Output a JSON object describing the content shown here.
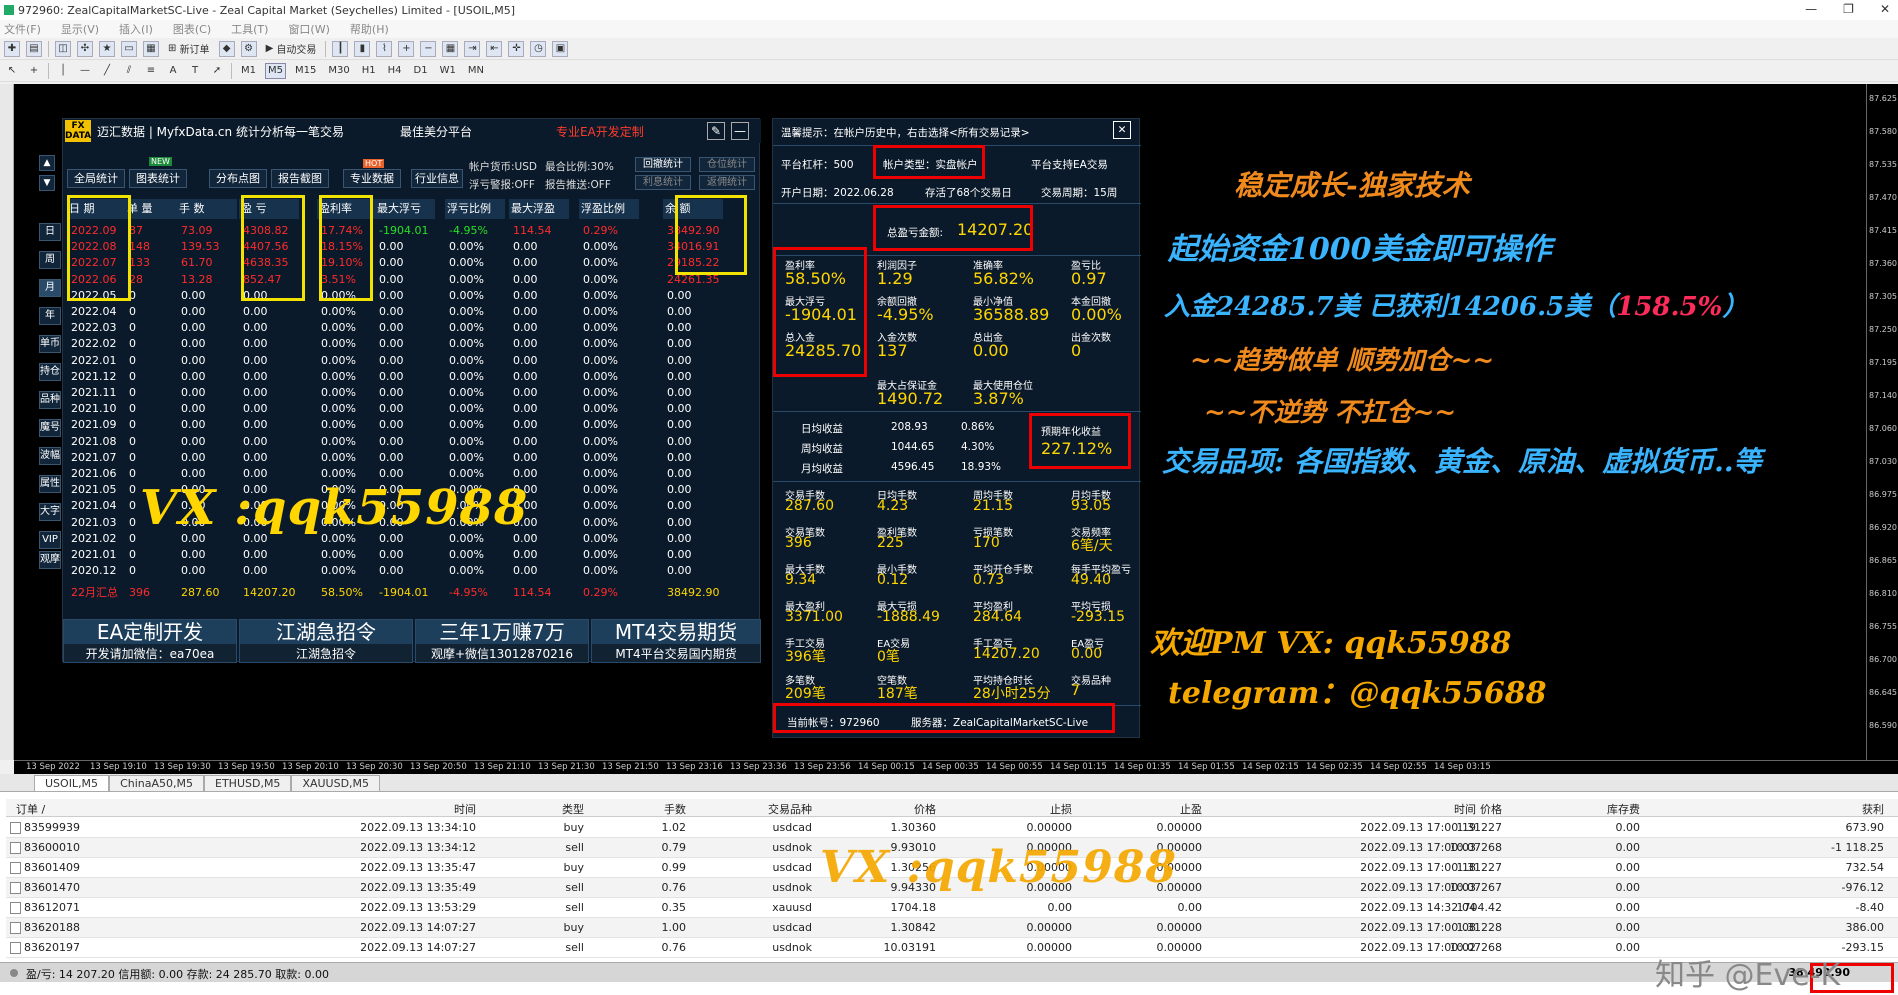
{
  "window": {
    "title": "972960: ZealCapitalMarketSC-Live - Zeal Capital Market (Seychelles) Limited - [USOIL,M5]",
    "controls": [
      "—",
      "❐",
      "✕"
    ]
  },
  "menu": [
    "文件(F)",
    "显示(V)",
    "插入(I)",
    "图表(C)",
    "工具(T)",
    "窗口(W)",
    "帮助(H)"
  ],
  "toolbar": {
    "new_order": "新订单",
    "autotrade": "自动交易",
    "timeframes": [
      "M1",
      "M5",
      "M15",
      "M30",
      "H1",
      "H4",
      "D1",
      "W1",
      "MN"
    ]
  },
  "left_panel": {
    "logo": "FX DATA",
    "header_title": "迈汇数据 | MyfxData.cn  统计分析每一笔交易",
    "header_mid": "最佳美分平台",
    "header_right": "专业EA开发定制",
    "buttons": [
      "全局统计",
      "图表统计",
      "分布点图",
      "报告截图",
      "专业数据",
      "行业信息"
    ],
    "new_badge": "NEW",
    "hot_badge": "HOT",
    "info": {
      "currency": "帐户货币:USD",
      "max_ratio": "最合比例:30%",
      "alarm": "浮亏警报:OFF",
      "push": "报告推送:OFF",
      "btn_withdraw": "回撤统计",
      "btn_position": "仓位统计",
      "btn_profit": "利息统计",
      "btn_rebate": "返佣统计"
    },
    "side_tabs": [
      "日",
      "周",
      "月",
      "年",
      "单币",
      "持仓",
      "品种",
      "魔号",
      "波幅",
      "属性",
      "大字",
      "VIP",
      "观摩"
    ],
    "columns": [
      "日 期",
      "单 量",
      "手 数",
      "盈 亏",
      "盈利率",
      "最大浮亏",
      "浮亏比例",
      "最大浮盈",
      "浮盈比例",
      "余 额"
    ],
    "rows": [
      [
        "2022.09",
        "87",
        "73.09",
        "4308.82",
        "17.74%",
        "-1904.01",
        "-4.95%",
        "114.54",
        "0.29%",
        "38492.90"
      ],
      [
        "2022.08",
        "148",
        "139.53",
        "4407.56",
        "18.15%",
        "0.00",
        "0.00%",
        "0.00",
        "0.00%",
        "34016.91"
      ],
      [
        "2022.07",
        "133",
        "61.70",
        "4638.35",
        "19.10%",
        "0.00",
        "0.00%",
        "0.00",
        "0.00%",
        "29185.22"
      ],
      [
        "2022.06",
        "28",
        "13.28",
        "852.47",
        "3.51%",
        "0.00",
        "0.00%",
        "0.00",
        "0.00%",
        "24261.35"
      ],
      [
        "2022.05",
        "0",
        "0.00",
        "0.00",
        "0.00%",
        "0.00",
        "0.00%",
        "0.00",
        "0.00%",
        "0.00"
      ],
      [
        "2022.04",
        "0",
        "0.00",
        "0.00",
        "0.00%",
        "0.00",
        "0.00%",
        "0.00",
        "0.00%",
        "0.00"
      ],
      [
        "2022.03",
        "0",
        "0.00",
        "0.00",
        "0.00%",
        "0.00",
        "0.00%",
        "0.00",
        "0.00%",
        "0.00"
      ],
      [
        "2022.02",
        "0",
        "0.00",
        "0.00",
        "0.00%",
        "0.00",
        "0.00%",
        "0.00",
        "0.00%",
        "0.00"
      ],
      [
        "2022.01",
        "0",
        "0.00",
        "0.00",
        "0.00%",
        "0.00",
        "0.00%",
        "0.00",
        "0.00%",
        "0.00"
      ],
      [
        "2021.12",
        "0",
        "0.00",
        "0.00",
        "0.00%",
        "0.00",
        "0.00%",
        "0.00",
        "0.00%",
        "0.00"
      ],
      [
        "2021.11",
        "0",
        "0.00",
        "0.00",
        "0.00%",
        "0.00",
        "0.00%",
        "0.00",
        "0.00%",
        "0.00"
      ],
      [
        "2021.10",
        "0",
        "0.00",
        "0.00",
        "0.00%",
        "0.00",
        "0.00%",
        "0.00",
        "0.00%",
        "0.00"
      ],
      [
        "2021.09",
        "0",
        "0.00",
        "0.00",
        "0.00%",
        "0.00",
        "0.00%",
        "0.00",
        "0.00%",
        "0.00"
      ],
      [
        "2021.08",
        "0",
        "0.00",
        "0.00",
        "0.00%",
        "0.00",
        "0.00%",
        "0.00",
        "0.00%",
        "0.00"
      ],
      [
        "2021.07",
        "0",
        "0.00",
        "0.00",
        "0.00%",
        "0.00",
        "0.00%",
        "0.00",
        "0.00%",
        "0.00"
      ],
      [
        "2021.06",
        "0",
        "0.00",
        "0.00",
        "0.00%",
        "0.00",
        "0.00%",
        "0.00",
        "0.00%",
        "0.00"
      ],
      [
        "2021.05",
        "0",
        "0.00",
        "0.00",
        "0.00%",
        "0.00",
        "0.00%",
        "0.00",
        "0.00%",
        "0.00"
      ],
      [
        "2021.04",
        "0",
        "0.00",
        "0.00",
        "0.00%",
        "0.00",
        "0.00%",
        "0.00",
        "0.00%",
        "0.00"
      ],
      [
        "2021.03",
        "0",
        "0.00",
        "0.00",
        "0.00%",
        "0.00",
        "0.00%",
        "0.00",
        "0.00%",
        "0.00"
      ],
      [
        "2021.02",
        "0",
        "0.00",
        "0.00",
        "0.00%",
        "0.00",
        "0.00%",
        "0.00",
        "0.00%",
        "0.00"
      ],
      [
        "2021.01",
        "0",
        "0.00",
        "0.00",
        "0.00%",
        "0.00",
        "0.00%",
        "0.00",
        "0.00%",
        "0.00"
      ],
      [
        "2020.12",
        "0",
        "0.00",
        "0.00",
        "0.00%",
        "0.00",
        "0.00%",
        "0.00",
        "0.00%",
        "0.00"
      ]
    ],
    "summary": [
      "22月汇总",
      "396",
      "287.60",
      "14207.20",
      "58.50%",
      "-1904.01",
      "-4.95%",
      "114.54",
      "0.29%",
      "38492.90"
    ],
    "bottom": [
      {
        "title": "EA定制开发",
        "sub": "开发请加微信：ea70ea"
      },
      {
        "title": "江湖急招令",
        "sub": "江湖急招令"
      },
      {
        "title": "三年1万赚7万",
        "sub": "观摩+微信13012870216"
      },
      {
        "title": "MT4交易期货",
        "sub": "MT4平台交易国内期货"
      }
    ]
  },
  "right_panel": {
    "tip": "温馨提示：在帐户历史中，右击选择<所有交易记录>",
    "close": "✕",
    "leverage": "平台杠杆：500",
    "acct_type": "帐户类型：实盘帐户",
    "ea_support": "平台支持EA交易",
    "open_date": "开户日期：2022.06.28",
    "records": "存活了68个交易日",
    "period": "交易周期：15周",
    "total_label": "总盈亏金额:",
    "total_value": "14207.20",
    "stats1": [
      {
        "label": "盈利率",
        "value": "58.50%"
      },
      {
        "label": "利润因子",
        "value": "1.29"
      },
      {
        "label": "准确率",
        "value": "56.82%"
      },
      {
        "label": "盈亏比",
        "value": "0.97"
      },
      {
        "label": "最大浮亏",
        "value": "-1904.01"
      },
      {
        "label": "余额回撤",
        "value": "-4.95%"
      },
      {
        "label": "最小净值",
        "value": "36588.89"
      },
      {
        "label": "本金回撤",
        "value": "0.00%"
      },
      {
        "label": "总入金",
        "value": "24285.70"
      },
      {
        "label": "入金次数",
        "value": "137"
      },
      {
        "label": "总出金",
        "value": "0.00"
      },
      {
        "label": "出金次数",
        "value": "0"
      }
    ],
    "margin_label": "最大占保证金",
    "margin_value": "1490.72",
    "maxpos_label": "最大使用仓位",
    "maxpos_value": "3.87%",
    "income": [
      {
        "label": "日均收益",
        "v1": "208.93",
        "v2": "0.86%"
      },
      {
        "label": "周均收益",
        "v1": "1044.65",
        "v2": "4.30%"
      },
      {
        "label": "月均收益",
        "v1": "4596.45",
        "v2": "18.93%"
      }
    ],
    "annual_label": "预期年化收益",
    "annual_value": "227.12%",
    "stats2": [
      {
        "label": "交易手数",
        "value": "287.60"
      },
      {
        "label": "日均手数",
        "value": "4.23"
      },
      {
        "label": "周均手数",
        "value": "21.15"
      },
      {
        "label": "月均手数",
        "value": "93.05"
      },
      {
        "label": "交易笔数",
        "value": "396"
      },
      {
        "label": "盈利笔数",
        "value": "225"
      },
      {
        "label": "亏损笔数",
        "value": "170"
      },
      {
        "label": "交易频率",
        "value": "6笔/天"
      },
      {
        "label": "最大手数",
        "value": "9.34"
      },
      {
        "label": "最小手数",
        "value": "0.12"
      },
      {
        "label": "平均开仓手数",
        "value": "0.73"
      },
      {
        "label": "每手平均盈亏",
        "value": "49.40"
      },
      {
        "label": "最大盈利",
        "value": "3371.00"
      },
      {
        "label": "最大亏损",
        "value": "-1888.49"
      },
      {
        "label": "平均盈利",
        "value": "284.64"
      },
      {
        "label": "平均亏损",
        "value": "-293.15"
      },
      {
        "label": "手工交易",
        "value": "396笔"
      },
      {
        "label": "EA交易",
        "value": "0笔"
      },
      {
        "label": "手工盈亏",
        "value": "14207.20"
      },
      {
        "label": "EA盈亏",
        "value": "0.00"
      },
      {
        "label": "多笔数",
        "value": "209笔"
      },
      {
        "label": "空笔数",
        "value": "187笔"
      },
      {
        "label": "平均持仓时长",
        "value": "28小时25分"
      },
      {
        "label": "交易品种",
        "value": "7"
      }
    ],
    "account": "当前帐号：972960",
    "server": "服务器：ZealCapitalMarketSC-Live"
  },
  "promo": {
    "l1": "稳定成长-独家技术",
    "l2": "起始资金1000美金即可操作",
    "l3a": "入金24285.7美 已获利14206.5美（",
    "l3b": "158.5%",
    "l3c": "）",
    "l4": "~~趋势做单    顺势加仓~~",
    "l5": "~~不逆势      不扛仓~~",
    "l6": "交易品项: 各国指数、黄金、原油、虚拟货币..等",
    "l7": "欢迎PM    VX: qqk55988",
    "l8": "telegram：@qqk55688",
    "watermark1": "VX :qqk55988",
    "watermark2": "VX :qqk55988",
    "watermark3": "知乎 @Eve-K"
  },
  "price_scale": [
    "87.625",
    "87.580",
    "87.535",
    "87.470",
    "87.415",
    "87.360",
    "87.305",
    "87.250",
    "87.195",
    "87.140",
    "87.060",
    "87.030",
    "86.975",
    "86.920",
    "86.865",
    "86.810",
    "86.755",
    "86.700",
    "86.645",
    "86.590"
  ],
  "time_axis": [
    "13 Sep 2022",
    "13 Sep 19:10",
    "13 Sep 19:30",
    "13 Sep 19:50",
    "13 Sep 20:10",
    "13 Sep 20:30",
    "13 Sep 20:50",
    "13 Sep 21:10",
    "13 Sep 21:30",
    "13 Sep 21:50",
    "13 Sep 23:16",
    "13 Sep 23:36",
    "13 Sep 23:56",
    "14 Sep 00:15",
    "14 Sep 00:35",
    "14 Sep 00:55",
    "14 Sep 01:15",
    "14 Sep 01:35",
    "14 Sep 01:55",
    "14 Sep 02:15",
    "14 Sep 02:35",
    "14 Sep 02:55",
    "14 Sep 03:15"
  ],
  "chart_tabs": [
    "USOIL,M5",
    "ChinaA50,M5",
    "ETHUSD,M5",
    "XAUUSD,M5"
  ],
  "terminal": {
    "columns": [
      "订单 /",
      "时间",
      "类型",
      "手数",
      "交易品种",
      "价格",
      "止损",
      "止盈",
      "时间",
      "价格",
      "库存费",
      "获利"
    ],
    "rows": [
      [
        "83599939",
        "2022.09.13 13:34:10",
        "buy",
        "1.02",
        "usdcad",
        "1.30360",
        "0.00000",
        "0.00000",
        "2022.09.13 17:00:19",
        "1.31227",
        "0.00",
        "673.90"
      ],
      [
        "83600010",
        "2022.09.13 13:34:12",
        "sell",
        "0.79",
        "usdnok",
        "9.93010",
        "0.00000",
        "0.00000",
        "2022.09.13 17:00:03",
        "10.07268",
        "0.00",
        "-1 118.25"
      ],
      [
        "83601409",
        "2022.09.13 13:35:47",
        "buy",
        "0.99",
        "usdcad",
        "1.30256",
        "0.00000",
        "0.00000",
        "2022.09.13 17:00:18",
        "1.31227",
        "0.00",
        "732.54"
      ],
      [
        "83601470",
        "2022.09.13 13:35:49",
        "sell",
        "0.76",
        "usdnok",
        "9.94330",
        "0.00000",
        "0.00000",
        "2022.09.13 17:00:03",
        "10.07267",
        "0.00",
        "-976.12"
      ],
      [
        "83612071",
        "2022.09.13 13:53:29",
        "sell",
        "0.35",
        "xauusd",
        "1704.18",
        "0.00",
        "0.00",
        "2022.09.13 14:32:04",
        "1704.42",
        "0.00",
        "-8.40"
      ],
      [
        "83620188",
        "2022.09.13 14:07:27",
        "buy",
        "1.00",
        "usdcad",
        "1.30842",
        "0.00000",
        "0.00000",
        "2022.09.13 17:00:08",
        "1.31228",
        "0.00",
        "386.00"
      ],
      [
        "83620197",
        "2022.09.13 14:07:27",
        "sell",
        "0.76",
        "usdnok",
        "10.03191",
        "0.00000",
        "0.00000",
        "2022.09.13 17:00:02",
        "10.07268",
        "0.00",
        "-293.15"
      ]
    ],
    "footer": "盈/亏: 14 207.20  信用额: 0.00  存款: 24 285.70  取款: 0.00",
    "footer_total": "38 492.90"
  },
  "colors": {
    "panel_bg": "#0b1a2a",
    "highlight_yellow": "#ffd600",
    "highlight_red": "#ff2b2b",
    "promo_orange": "#f08a1c",
    "promo_blue": "#3ab4ff"
  }
}
